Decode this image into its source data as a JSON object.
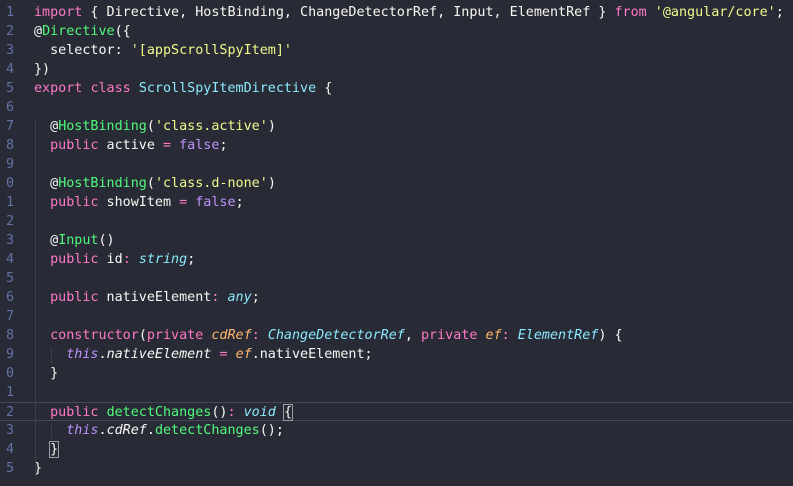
{
  "lines": [
    {
      "n": "1",
      "tokens": [
        {
          "t": "import",
          "c": "kw"
        },
        {
          "t": " { Directive, HostBinding, ChangeDetectorRef, Input, ElementRef } ",
          "c": "txt"
        },
        {
          "t": "from",
          "c": "kw"
        },
        {
          "t": " ",
          "c": "txt"
        },
        {
          "t": "'@angular/core'",
          "c": "str"
        },
        {
          "t": ";",
          "c": "txt"
        }
      ]
    },
    {
      "n": "2",
      "tokens": [
        {
          "t": "@",
          "c": "txt"
        },
        {
          "t": "Directive",
          "c": "dec"
        },
        {
          "t": "({",
          "c": "txt"
        }
      ]
    },
    {
      "n": "3",
      "tokens": [
        {
          "t": "  selector: ",
          "c": "txt"
        },
        {
          "t": "'[appScrollSpyItem]'",
          "c": "str"
        }
      ]
    },
    {
      "n": "4",
      "tokens": [
        {
          "t": "})",
          "c": "txt"
        }
      ]
    },
    {
      "n": "5",
      "tokens": [
        {
          "t": "export",
          "c": "kw"
        },
        {
          "t": " ",
          "c": "txt"
        },
        {
          "t": "class",
          "c": "kw"
        },
        {
          "t": " ",
          "c": "txt"
        },
        {
          "t": "ScrollSpyItemDirective",
          "c": "cls"
        },
        {
          "t": " {",
          "c": "txt"
        }
      ]
    },
    {
      "n": "6",
      "tokens": []
    },
    {
      "n": "7",
      "tokens": [
        {
          "t": "  @",
          "c": "txt"
        },
        {
          "t": "HostBinding",
          "c": "dec"
        },
        {
          "t": "(",
          "c": "txt"
        },
        {
          "t": "'class.active'",
          "c": "str"
        },
        {
          "t": ")",
          "c": "txt"
        }
      ]
    },
    {
      "n": "8",
      "tokens": [
        {
          "t": "  ",
          "c": "txt"
        },
        {
          "t": "public",
          "c": "kw"
        },
        {
          "t": " active ",
          "c": "txt"
        },
        {
          "t": "=",
          "c": "kw"
        },
        {
          "t": " ",
          "c": "txt"
        },
        {
          "t": "false",
          "c": "bool"
        },
        {
          "t": ";",
          "c": "txt"
        }
      ]
    },
    {
      "n": "9",
      "tokens": []
    },
    {
      "n": "0",
      "tokens": [
        {
          "t": "  @",
          "c": "txt"
        },
        {
          "t": "HostBinding",
          "c": "dec"
        },
        {
          "t": "(",
          "c": "txt"
        },
        {
          "t": "'class.d-none'",
          "c": "str"
        },
        {
          "t": ")",
          "c": "txt"
        }
      ]
    },
    {
      "n": "1",
      "tokens": [
        {
          "t": "  ",
          "c": "txt"
        },
        {
          "t": "public",
          "c": "kw"
        },
        {
          "t": " showItem ",
          "c": "txt"
        },
        {
          "t": "=",
          "c": "kw"
        },
        {
          "t": " ",
          "c": "txt"
        },
        {
          "t": "false",
          "c": "bool"
        },
        {
          "t": ";",
          "c": "txt"
        }
      ]
    },
    {
      "n": "2",
      "tokens": []
    },
    {
      "n": "3",
      "tokens": [
        {
          "t": "  @",
          "c": "txt"
        },
        {
          "t": "Input",
          "c": "dec"
        },
        {
          "t": "()",
          "c": "txt"
        }
      ]
    },
    {
      "n": "4",
      "tokens": [
        {
          "t": "  ",
          "c": "txt"
        },
        {
          "t": "public",
          "c": "kw"
        },
        {
          "t": " id",
          "c": "txt"
        },
        {
          "t": ":",
          "c": "kw"
        },
        {
          "t": " ",
          "c": "txt"
        },
        {
          "t": "string",
          "c": "type"
        },
        {
          "t": ";",
          "c": "txt"
        }
      ]
    },
    {
      "n": "5",
      "tokens": []
    },
    {
      "n": "6",
      "tokens": [
        {
          "t": "  ",
          "c": "txt"
        },
        {
          "t": "public",
          "c": "kw"
        },
        {
          "t": " nativeElement",
          "c": "txt"
        },
        {
          "t": ":",
          "c": "kw"
        },
        {
          "t": " ",
          "c": "txt"
        },
        {
          "t": "any",
          "c": "type"
        },
        {
          "t": ";",
          "c": "txt"
        }
      ]
    },
    {
      "n": "7",
      "tokens": []
    },
    {
      "n": "8",
      "tokens": [
        {
          "t": "  ",
          "c": "txt"
        },
        {
          "t": "constructor",
          "c": "kw"
        },
        {
          "t": "(",
          "c": "txt"
        },
        {
          "t": "private",
          "c": "kw"
        },
        {
          "t": " ",
          "c": "txt"
        },
        {
          "t": "cdRef",
          "c": "param"
        },
        {
          "t": ":",
          "c": "kw"
        },
        {
          "t": " ",
          "c": "txt"
        },
        {
          "t": "ChangeDetectorRef",
          "c": "type"
        },
        {
          "t": ", ",
          "c": "txt"
        },
        {
          "t": "private",
          "c": "kw"
        },
        {
          "t": " ",
          "c": "txt"
        },
        {
          "t": "ef",
          "c": "param"
        },
        {
          "t": ":",
          "c": "kw"
        },
        {
          "t": " ",
          "c": "txt"
        },
        {
          "t": "ElementRef",
          "c": "type"
        },
        {
          "t": ") {",
          "c": "txt"
        }
      ]
    },
    {
      "n": "9",
      "tokens": [
        {
          "t": "    ",
          "c": "txt"
        },
        {
          "t": "this",
          "c": "this"
        },
        {
          "t": ".",
          "c": "txt"
        },
        {
          "t": "nativeElement",
          "c": "prop"
        },
        {
          "t": " ",
          "c": "txt"
        },
        {
          "t": "=",
          "c": "kw"
        },
        {
          "t": " ",
          "c": "txt"
        },
        {
          "t": "ef",
          "c": "param"
        },
        {
          "t": ".nativeElement;",
          "c": "txt"
        }
      ]
    },
    {
      "n": "0",
      "tokens": [
        {
          "t": "  }",
          "c": "txt"
        }
      ]
    },
    {
      "n": "1",
      "tokens": []
    },
    {
      "n": "2",
      "current": true,
      "tokens": [
        {
          "t": "  ",
          "c": "txt"
        },
        {
          "t": "public",
          "c": "kw"
        },
        {
          "t": " ",
          "c": "txt"
        },
        {
          "t": "detectChanges",
          "c": "fn"
        },
        {
          "t": "()",
          "c": "txt"
        },
        {
          "t": ":",
          "c": "kw"
        },
        {
          "t": " ",
          "c": "txt"
        },
        {
          "t": "void",
          "c": "type"
        },
        {
          "t": " ",
          "c": "txt"
        },
        {
          "t": "{",
          "c": "txt bracket-match"
        }
      ]
    },
    {
      "n": "3",
      "tokens": [
        {
          "t": "    ",
          "c": "txt"
        },
        {
          "t": "this",
          "c": "this"
        },
        {
          "t": ".",
          "c": "txt"
        },
        {
          "t": "cdRef",
          "c": "prop"
        },
        {
          "t": ".",
          "c": "txt"
        },
        {
          "t": "detectChanges",
          "c": "fn"
        },
        {
          "t": "();",
          "c": "txt"
        }
      ]
    },
    {
      "n": "4",
      "tokens": [
        {
          "t": "  ",
          "c": "txt"
        },
        {
          "t": "}",
          "c": "txt bracket-match"
        }
      ]
    },
    {
      "n": "5",
      "tokens": [
        {
          "t": "}",
          "c": "txt"
        }
      ]
    }
  ]
}
